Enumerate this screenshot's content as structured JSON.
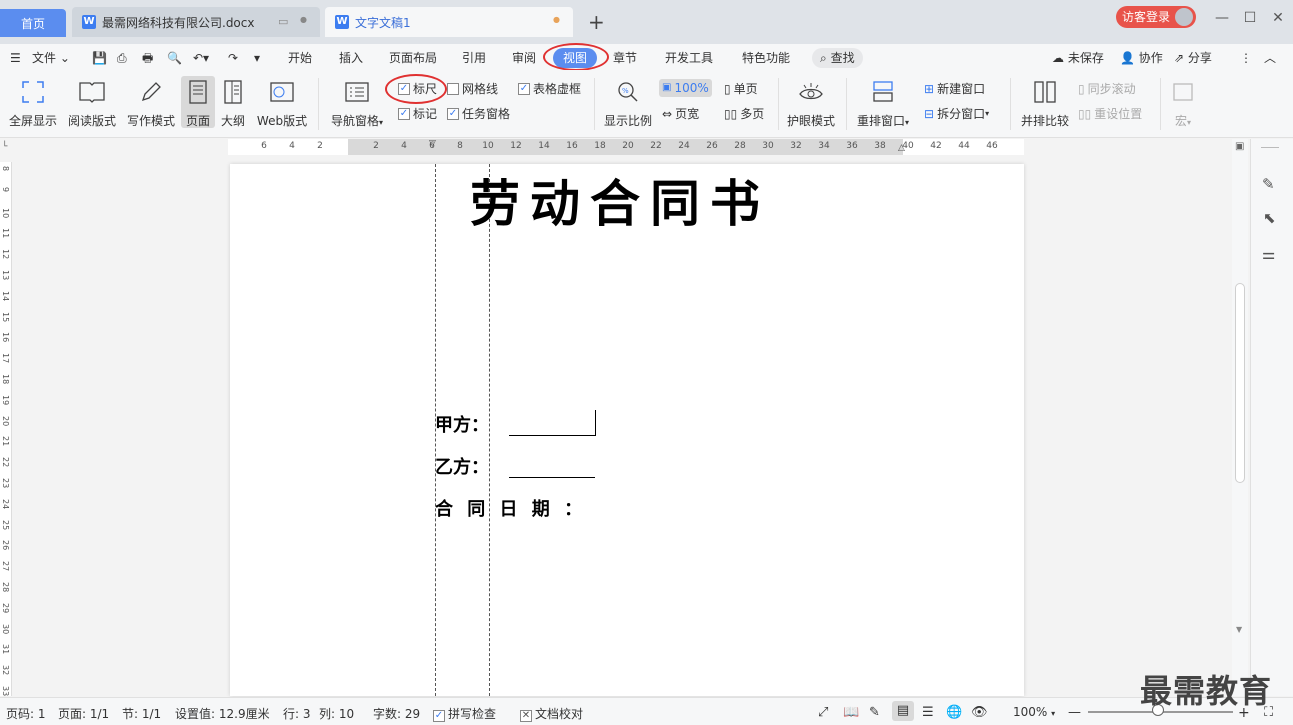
{
  "tabs": {
    "home": "首页",
    "doc": "最需网络科技有限公司.docx",
    "active": "文字文稿1",
    "new_tab": "+"
  },
  "login": "访客登录",
  "menu": {
    "file": "文件",
    "items": [
      "开始",
      "插入",
      "页面布局",
      "引用",
      "审阅",
      "视图",
      "章节",
      "开发工具",
      "特色功能"
    ],
    "find": "查找",
    "unsaved": "未保存",
    "collab": "协作",
    "share": "分享"
  },
  "ribbon": {
    "fullscreen": "全屏显示",
    "reading": "阅读版式",
    "writing": "写作模式",
    "page": "页面",
    "outline": "大纲",
    "web": "Web版式",
    "nav_pane": "导航窗格",
    "ruler": "标尺",
    "gridlines": "网格线",
    "table_grid": "表格虚框",
    "marks": "标记",
    "task_pane": "任务窗格",
    "zoom_ratio": "显示比例",
    "zoom_100": "100%",
    "page_width": "页宽",
    "single_page": "单页",
    "multi_page": "多页",
    "eye_mode": "护眼模式",
    "rearrange": "重排窗口",
    "new_window": "新建窗口",
    "split_window": "拆分窗口",
    "side_by_side": "并排比较",
    "sync_scroll": "同步滚动",
    "reset_pos": "重设位置",
    "macro": "宏"
  },
  "ruler_ticks": [
    "6",
    "4",
    "2",
    "2",
    "4",
    "6",
    "8",
    "10",
    "12",
    "14",
    "16",
    "18",
    "20",
    "22",
    "24",
    "26",
    "28",
    "30",
    "32",
    "34",
    "36",
    "38",
    "40",
    "42",
    "44",
    "46"
  ],
  "vruler_ticks": [
    "8",
    "9",
    "10",
    "11",
    "12",
    "13",
    "14",
    "15",
    "16",
    "17",
    "18",
    "19",
    "20",
    "21",
    "22",
    "23",
    "24",
    "25",
    "26",
    "27",
    "28",
    "29",
    "30",
    "31",
    "32",
    "33"
  ],
  "document": {
    "title": "劳动合同书",
    "party_a": "甲方：",
    "party_b": "乙方：",
    "date": "合 同 日 期 ："
  },
  "status": {
    "page_no": "页码: 1",
    "pages": "页面: 1/1",
    "section": "节: 1/1",
    "setting": "设置值: 12.9厘米",
    "row": "行: 3",
    "col": "列: 10",
    "word_count": "字数: 29",
    "spell_check": "拼写检查",
    "doc_proof": "文档校对",
    "zoom": "100%"
  },
  "watermark": "最需教育",
  "colors": {
    "accent": "#5b8def",
    "highlight_circle": "#e03131",
    "login": "#e8534a"
  }
}
